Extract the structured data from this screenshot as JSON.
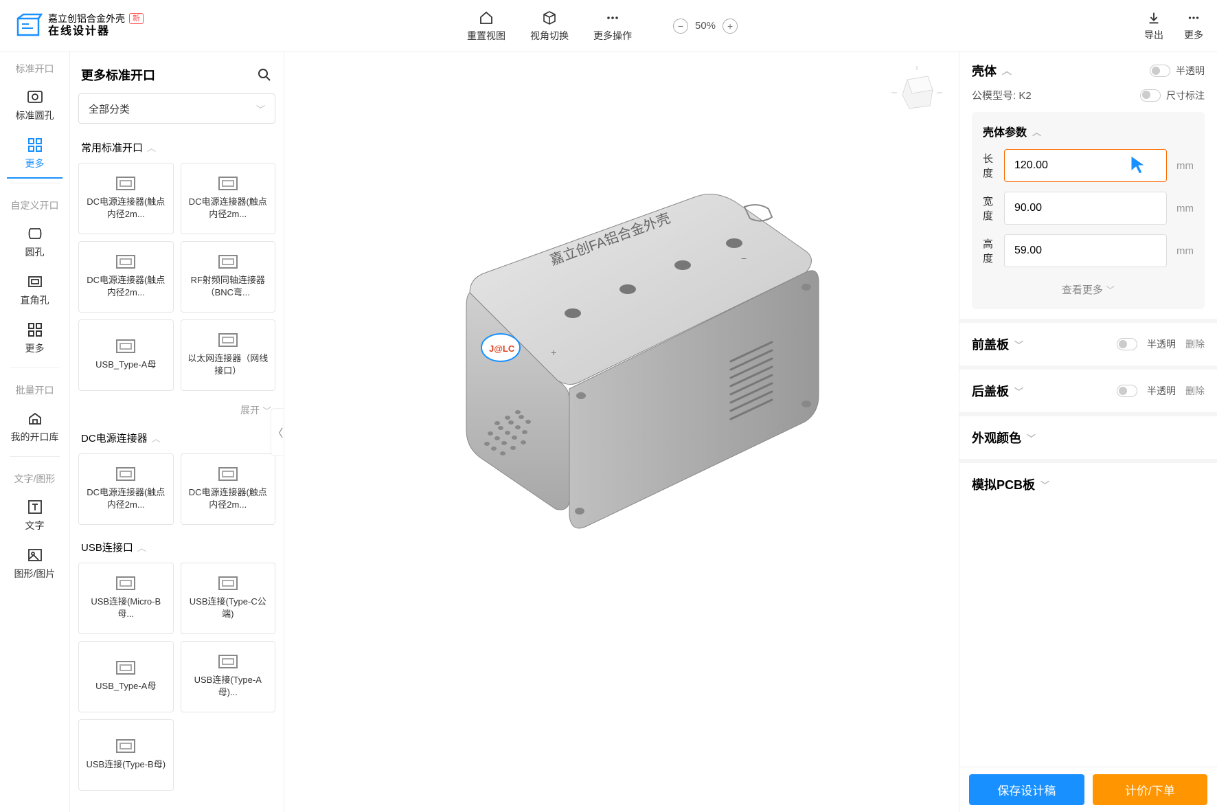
{
  "header": {
    "brand_line1": "嘉立创铝合金外壳",
    "brand_badge": "新",
    "brand_line2": "在线设计器",
    "actions": {
      "reset_view": "重置视图",
      "switch_view": "视角切换",
      "more_ops": "更多操作",
      "export": "导出",
      "more": "更多"
    },
    "zoom": "50%"
  },
  "left_rail": {
    "group1": "标准开口",
    "std_hole": "标准圆孔",
    "more": "更多",
    "group2": "自定义开口",
    "circle_hole": "圆孔",
    "rect_hole": "直角孔",
    "custom_more": "更多",
    "group3": "批量开口",
    "my_lib": "我的开口库",
    "group4": "文字/图形",
    "text": "文字",
    "graphic": "图形/图片"
  },
  "library": {
    "title": "更多标准开口",
    "category": "全部分类",
    "section1": "常用标准开口",
    "cards1": [
      "DC电源连接器(触点内径2m...",
      "DC电源连接器(触点内径2m...",
      "DC电源连接器(触点内径2m...",
      "RF射频同轴连接器（BNC弯...",
      "USB_Type-A母",
      "以太网连接器（网线接口）"
    ],
    "expand": "展开",
    "section2": "DC电源连接器",
    "cards2": [
      "DC电源连接器(触点内径2m...",
      "DC电源连接器(触点内径2m..."
    ],
    "section3": "USB连接口",
    "cards3": [
      "USB连接(Micro-B母...",
      "USB连接(Type-C公端)",
      "USB_Type-A母",
      "USB连接(Type-A母)...",
      "USB连接(Type-B母)"
    ]
  },
  "properties": {
    "shell": {
      "title": "壳体",
      "translucent": "半透明",
      "model_label": "公模型号:",
      "model_value": "K2",
      "dim_label": "尺寸标注",
      "params_title": "壳体参数",
      "length_label": "长度",
      "length_value": "120.00",
      "width_label": "宽度",
      "width_value": "90.00",
      "height_label": "高度",
      "height_value": "59.00",
      "unit": "mm",
      "show_more": "查看更多"
    },
    "front_cover": {
      "title": "前盖板",
      "translucent": "半透明",
      "delete": "删除"
    },
    "back_cover": {
      "title": "后盖板",
      "translucent": "半透明",
      "delete": "删除"
    },
    "appearance": {
      "title": "外观颜色"
    },
    "pcb": {
      "title": "模拟PCB板"
    },
    "buttons": {
      "save": "保存设计稿",
      "order": "计价/下单"
    }
  }
}
